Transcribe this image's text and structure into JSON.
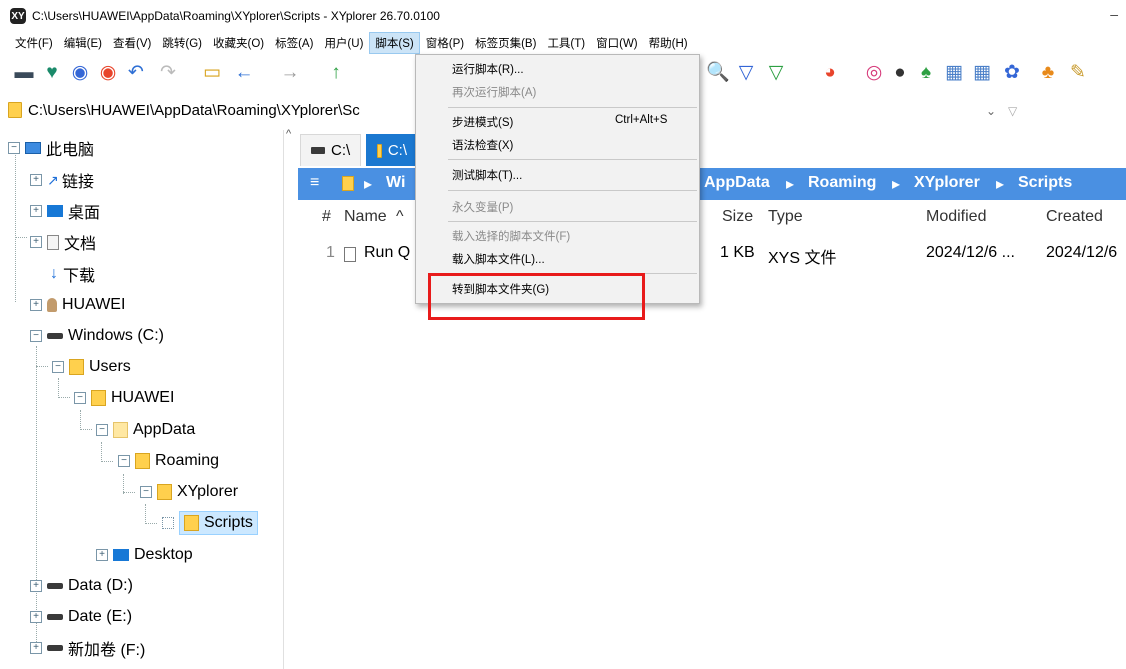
{
  "window": {
    "title": "C:\\Users\\HUAWEI\\AppData\\Roaming\\XYplorer\\Scripts - XYplorer 26.70.0100",
    "app_icon": "XY",
    "minimize": "–"
  },
  "menubar": [
    "文件(F)",
    "编辑(E)",
    "查看(V)",
    "跳转(G)",
    "收藏夹(O)",
    "标签(A)",
    "用户(U)",
    "脚本(S)",
    "窗格(P)",
    "标签页集(B)",
    "工具(T)",
    "窗口(W)",
    "帮助(H)"
  ],
  "address": {
    "path": "C:\\Users\\HUAWEI\\AppData\\Roaming\\XYplorer\\Sc",
    "dropdown": "⌄",
    "filter": "▽"
  },
  "tree": {
    "items": [
      "此电脑",
      "链接",
      "桌面",
      "文档",
      "下载",
      "HUAWEI",
      "Windows (C:)",
      "Users",
      "HUAWEI",
      "AppData",
      "Roaming",
      "XYplorer",
      "Scripts",
      "Desktop",
      "Data (D:)",
      "Date (E:)",
      "新加卷 (F:)"
    ],
    "expanders": {
      "collapsed": "+",
      "expanded": "−"
    }
  },
  "tabs": {
    "tab1": "C:\\",
    "tab2": "C:\\"
  },
  "breadcrumb": {
    "menu": "≡",
    "sep": "▸",
    "win_partial": "Wi",
    "items": [
      "AppData",
      "Roaming",
      "XYplorer",
      "Scripts"
    ]
  },
  "columns": {
    "num": "#",
    "name": "Name",
    "sort": "^",
    "size": "Size",
    "type": "Type",
    "modified": "Modified",
    "created": "Created"
  },
  "file_row": {
    "num": "1",
    "name": "Run Q",
    "size": "1 KB",
    "type": "XYS 文件",
    "modified": "2024/12/6 ...",
    "created": "2024/12/6"
  },
  "script_menu": {
    "items": [
      {
        "label": "运行脚本(R)...",
        "disabled": false
      },
      {
        "label": "再次运行脚本(A)",
        "disabled": true
      },
      {
        "label": "步进模式(S)",
        "shortcut": "Ctrl+Alt+S",
        "disabled": false
      },
      {
        "label": "语法检查(X)",
        "disabled": false
      },
      {
        "label": "测试脚本(T)...",
        "disabled": false
      },
      {
        "label": "永久变量(P)",
        "disabled": true
      },
      {
        "label": "载入选择的脚本文件(F)",
        "disabled": true
      },
      {
        "label": "载入脚本文件(L)...",
        "disabled": false
      },
      {
        "label": "转到脚本文件夹(G)",
        "disabled": false
      }
    ]
  },
  "toolbar_icons": {
    "left": [
      "▬",
      "♥",
      "◉",
      "◉",
      "↶",
      "↷",
      "▭",
      "←",
      "→",
      "↑"
    ],
    "right": [
      "🔍",
      "▽",
      "▽",
      "◕",
      "◎",
      "●",
      "♠",
      "▦",
      "▦",
      "✿",
      "♣",
      "✎"
    ]
  },
  "colors": {
    "accent": "#1b78d0",
    "breadcrumb": "#4a90e2",
    "highlight": "#e81b1b",
    "selection": "#cce8ff"
  }
}
